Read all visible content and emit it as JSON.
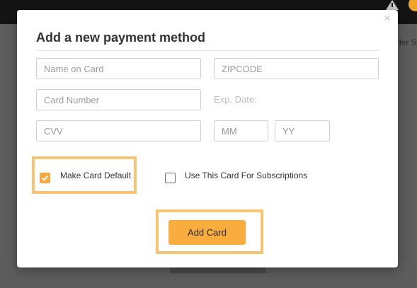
{
  "background": {
    "partial_text": "der S"
  },
  "modal": {
    "close_glyph": "×",
    "title": "Add a new payment method",
    "fields": {
      "name_on_card": {
        "placeholder": "Name on Card",
        "value": ""
      },
      "zipcode": {
        "placeholder": "ZIPCODE",
        "value": ""
      },
      "card_number": {
        "placeholder": "Card Number",
        "value": ""
      },
      "exp_label": "Exp. Date:",
      "cvv": {
        "placeholder": "CVV",
        "value": ""
      },
      "exp_month": {
        "placeholder": "MM",
        "value": ""
      },
      "exp_year": {
        "placeholder": "YY",
        "value": ""
      }
    },
    "checkboxes": {
      "make_default": {
        "label": "Make Card Default",
        "checked": true
      },
      "subscriptions": {
        "label": "Use This Card For Subscriptions",
        "checked": false
      }
    },
    "add_button_label": "Add Card"
  },
  "colors": {
    "accent": "#f8ad3e",
    "highlight": "#f7c474",
    "overlay": "#5d5d5d"
  }
}
